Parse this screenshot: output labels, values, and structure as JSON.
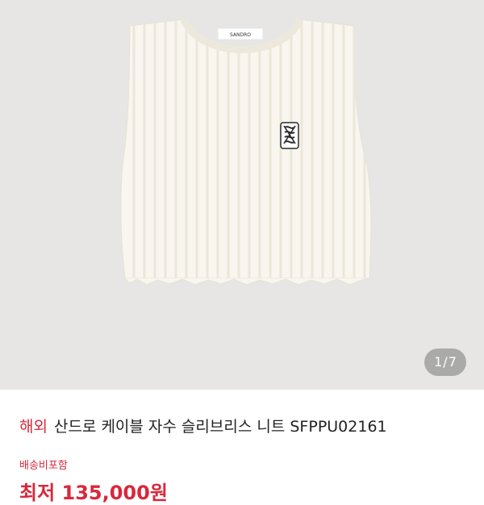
{
  "gallery": {
    "counter_current": "1",
    "counter_separator": "/",
    "counter_total": "7",
    "neck_label_text": "SANDRO"
  },
  "product": {
    "region_badge": "해외",
    "title": "산드로 케이블 자수 슬리브리스 니트 SFPPU02161",
    "shipping_note": "배송비포함",
    "price_partial": "최저 135,000원"
  },
  "colors": {
    "accent": "#d8283b",
    "background": "#e7e6e4",
    "knit": "#f8f6ee"
  }
}
